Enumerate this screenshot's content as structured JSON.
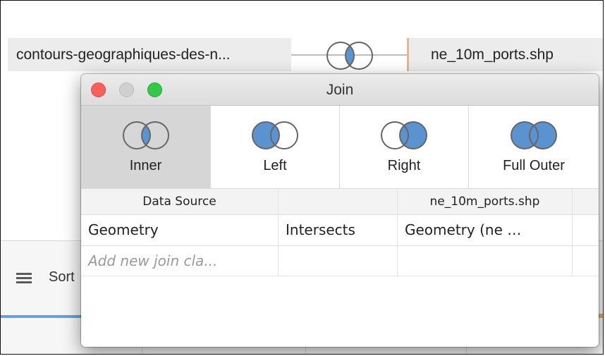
{
  "canvas": {
    "left_source": "contours-geographiques-des-n...",
    "right_source": "ne_10m_ports.shp",
    "sort_label": "Sort"
  },
  "dialog": {
    "title": "Join",
    "join_types": [
      {
        "label": "Inner",
        "selected": true
      },
      {
        "label": "Left",
        "selected": false
      },
      {
        "label": "Right",
        "selected": false
      },
      {
        "label": "Full Outer",
        "selected": false
      }
    ],
    "grid": {
      "headers": [
        "Data Source",
        "",
        "ne_10m_ports.shp",
        ""
      ],
      "condition": {
        "left_field": "Geometry",
        "operator": "Intersects",
        "right_field": "Geometry (ne …"
      },
      "add_clause": "Add new join cla..."
    }
  },
  "colors": {
    "venn_fill": "#5b93d1",
    "venn_stroke": "#666666",
    "accent_orange": "#f0b47e"
  }
}
